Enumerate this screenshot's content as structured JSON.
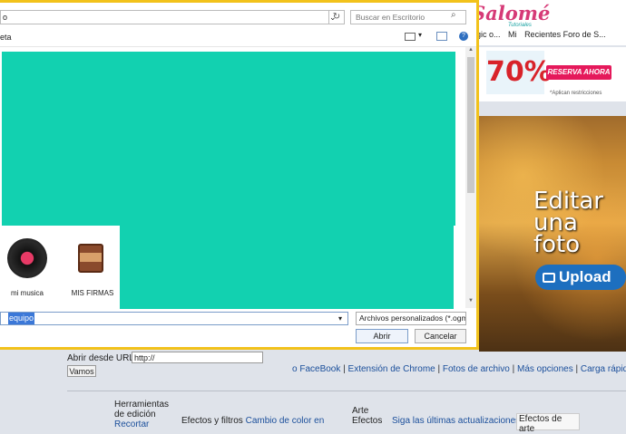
{
  "browser": {
    "bookmarks": [
      "he magic o...",
      "Mi",
      "Recientes Foro de S..."
    ],
    "logo_text": "Salomé",
    "logo_sub": "Tutoriales"
  },
  "ad_top": {
    "discount": "70%",
    "button": "RESERVA AHORA",
    "fineprint": "*Aplican restricciones"
  },
  "ad_right": {
    "headline_1": "Editar",
    "headline_2": "una",
    "headline_3": "foto",
    "upload": "Upload"
  },
  "page": {
    "open_url_label": "Abrir desde URL:",
    "open_url_value": "http://",
    "go_button": "Vamos",
    "links": [
      "FaceBook",
      "Extensión de Chrome",
      "Fotos de archivo",
      "Más opciones",
      "Carga rápida"
    ],
    "columns": {
      "col1": [
        "Herramientas",
        "de edición",
        "Recortar"
      ],
      "col2_label": "Efectos y filtros",
      "col2_link": "Cambio de color en",
      "col3": [
        "Arte",
        "Efectos"
      ],
      "col4": "Siga las últimas actualizaciones",
      "col5": "Efectos de arte"
    }
  },
  "dialog": {
    "address": "o",
    "search_placeholder": "Buscar en Escritorio",
    "toolbar_label": "eta",
    "files": [
      {
        "name": "mi musica",
        "icon": "vinyl-record-icon"
      },
      {
        "name": "MIS FIRMAS",
        "icon": "scrapbook-icon"
      }
    ],
    "filename_value": "equipo",
    "filetype_value": "Archivos personalizados (*.ogm",
    "open_button": "Abrir",
    "cancel_button": "Cancelar",
    "accent_color": "#f2c21b",
    "redaction_color": "#12d1b0"
  }
}
